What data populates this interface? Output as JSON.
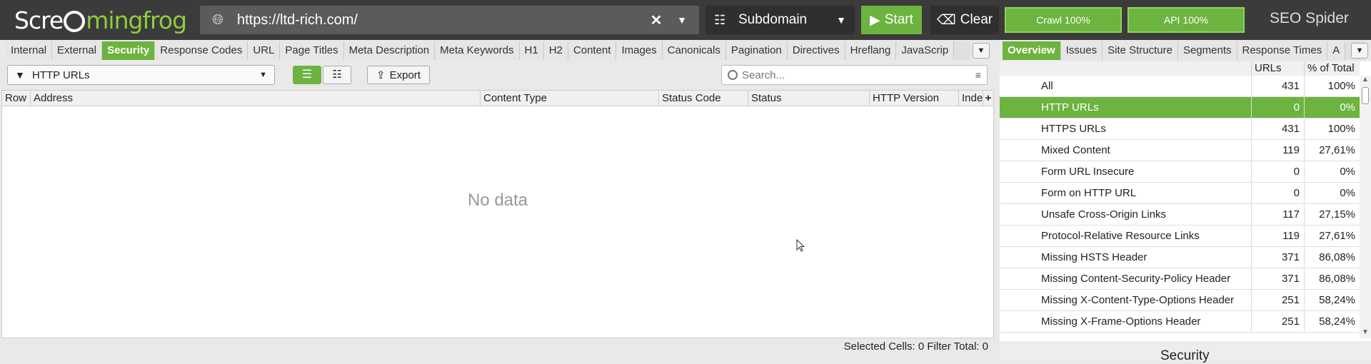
{
  "app": {
    "logo_left": "Scre",
    "logo_right": "mingfrog",
    "brand": "SEO Spider"
  },
  "toolbar": {
    "url": "https://ltd-rich.com/",
    "mode": "Subdomain",
    "start_label": "Start",
    "clear_label": "Clear",
    "crawl_progress": "Crawl 100%",
    "api_progress": "API 100%"
  },
  "main_tabs": [
    {
      "label": "Internal",
      "active": false
    },
    {
      "label": "External",
      "active": false
    },
    {
      "label": "Security",
      "active": true
    },
    {
      "label": "Response Codes",
      "active": false
    },
    {
      "label": "URL",
      "active": false
    },
    {
      "label": "Page Titles",
      "active": false
    },
    {
      "label": "Meta Description",
      "active": false
    },
    {
      "label": "Meta Keywords",
      "active": false
    },
    {
      "label": "H1",
      "active": false
    },
    {
      "label": "H2",
      "active": false
    },
    {
      "label": "Content",
      "active": false
    },
    {
      "label": "Images",
      "active": false
    },
    {
      "label": "Canonicals",
      "active": false
    },
    {
      "label": "Pagination",
      "active": false
    },
    {
      "label": "Directives",
      "active": false
    },
    {
      "label": "Hreflang",
      "active": false
    },
    {
      "label": "JavaScrip",
      "active": false
    }
  ],
  "side_tabs": [
    {
      "label": "Overview",
      "active": true
    },
    {
      "label": "Issues",
      "active": false
    },
    {
      "label": "Site Structure",
      "active": false
    },
    {
      "label": "Segments",
      "active": false
    },
    {
      "label": "Response Times",
      "active": false
    },
    {
      "label": "A",
      "active": false
    }
  ],
  "filter": {
    "selected": "HTTP URLs",
    "export_label": "Export",
    "search_placeholder": "Search..."
  },
  "grid": {
    "columns": [
      "Row",
      "Address",
      "Content Type",
      "Status Code",
      "Status",
      "HTTP Version",
      "Index"
    ],
    "empty_message": "No data",
    "status_text": "Selected Cells:  0  Filter Total:  0"
  },
  "overview": {
    "header_urls": "URLs",
    "header_pct": "% of Total",
    "rows": [
      {
        "name": "All",
        "urls": "431",
        "pct": "100%",
        "selected": false
      },
      {
        "name": "HTTP URLs",
        "urls": "0",
        "pct": "0%",
        "selected": true
      },
      {
        "name": "HTTPS URLs",
        "urls": "431",
        "pct": "100%",
        "selected": false
      },
      {
        "name": "Mixed Content",
        "urls": "119",
        "pct": "27,61%",
        "selected": false
      },
      {
        "name": "Form URL Insecure",
        "urls": "0",
        "pct": "0%",
        "selected": false
      },
      {
        "name": "Form on HTTP URL",
        "urls": "0",
        "pct": "0%",
        "selected": false
      },
      {
        "name": "Unsafe Cross-Origin Links",
        "urls": "117",
        "pct": "27,15%",
        "selected": false
      },
      {
        "name": "Protocol-Relative Resource Links",
        "urls": "119",
        "pct": "27,61%",
        "selected": false
      },
      {
        "name": "Missing HSTS Header",
        "urls": "371",
        "pct": "86,08%",
        "selected": false
      },
      {
        "name": "Missing Content-Security-Policy Header",
        "urls": "371",
        "pct": "86,08%",
        "selected": false
      },
      {
        "name": "Missing X-Content-Type-Options Header",
        "urls": "251",
        "pct": "58,24%",
        "selected": false
      },
      {
        "name": "Missing X-Frame-Options Header",
        "urls": "251",
        "pct": "58,24%",
        "selected": false
      }
    ],
    "section_title": "Security"
  }
}
